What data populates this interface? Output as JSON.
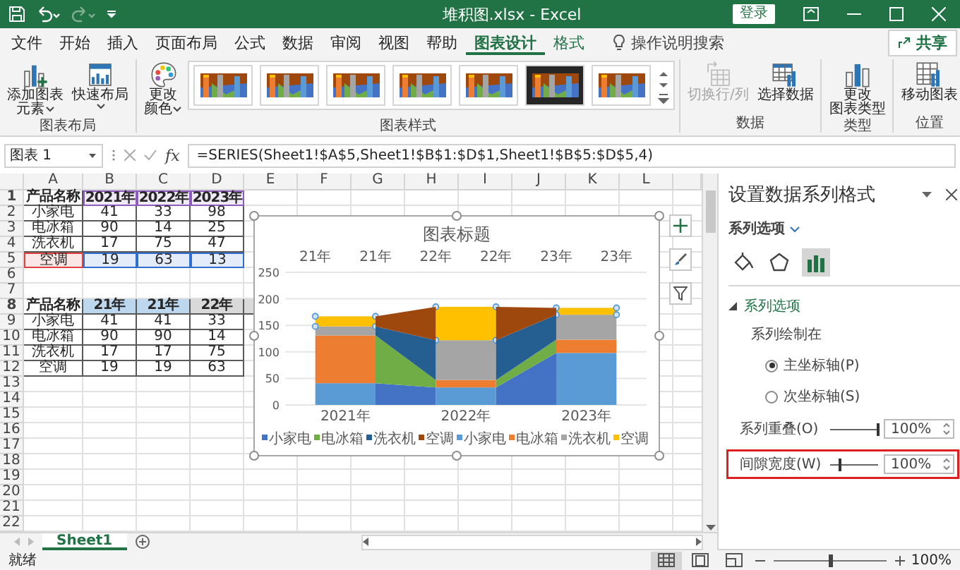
{
  "window": {
    "title": "堆积图.xlsx - Excel",
    "sign_in": "登录"
  },
  "quick_access": [
    {
      "kind": "save",
      "disabled": false
    },
    {
      "kind": "undo",
      "disabled": false
    },
    {
      "kind": "redo",
      "disabled": true
    },
    {
      "kind": "customize",
      "disabled": false
    }
  ],
  "tabs": [
    {
      "label": "文件",
      "selected": false,
      "contextual": false
    },
    {
      "label": "开始",
      "selected": false,
      "contextual": false
    },
    {
      "label": "插入",
      "selected": false,
      "contextual": false
    },
    {
      "label": "页面布局",
      "selected": false,
      "contextual": false
    },
    {
      "label": "公式",
      "selected": false,
      "contextual": false
    },
    {
      "label": "数据",
      "selected": false,
      "contextual": false
    },
    {
      "label": "审阅",
      "selected": false,
      "contextual": false
    },
    {
      "label": "视图",
      "selected": false,
      "contextual": false
    },
    {
      "label": "帮助",
      "selected": false,
      "contextual": false
    },
    {
      "label": "图表设计",
      "selected": true,
      "contextual": true
    },
    {
      "label": "格式",
      "selected": false,
      "contextual": true
    }
  ],
  "tell_me": "操作说明搜索",
  "share": "共享",
  "ribbon_groups": [
    {
      "label": "图表布局",
      "buttons": [
        {
          "kind": "add-element",
          "lines": [
            "添加图表",
            "元素"
          ],
          "dropdown": true,
          "disabled": false
        },
        {
          "kind": "quick-layout",
          "lines": [
            "快速布局"
          ],
          "dropdown": true,
          "disabled": false
        }
      ]
    },
    {
      "label": "图表样式",
      "buttons": [
        {
          "kind": "colors",
          "lines": [
            "更改",
            "颜色"
          ],
          "dropdown": true,
          "disabled": false
        }
      ],
      "styles": [
        {
          "kind": "light"
        },
        {
          "kind": "light"
        },
        {
          "kind": "light"
        },
        {
          "kind": "light"
        },
        {
          "kind": "light"
        },
        {
          "kind": "dark"
        },
        {
          "kind": "light"
        }
      ]
    },
    {
      "label": "数据",
      "buttons": [
        {
          "kind": "switch",
          "lines": [
            "切换行/列"
          ],
          "dropdown": false,
          "disabled": true
        },
        {
          "kind": "select-data",
          "lines": [
            "选择数据"
          ],
          "dropdown": false,
          "disabled": false
        }
      ]
    },
    {
      "label": "类型",
      "buttons": [
        {
          "kind": "change-type",
          "lines": [
            "更改",
            "图表类型"
          ],
          "dropdown": false,
          "disabled": false
        }
      ]
    },
    {
      "label": "位置",
      "buttons": [
        {
          "kind": "move",
          "lines": [
            "移动图表"
          ],
          "dropdown": false,
          "disabled": false
        }
      ]
    }
  ],
  "formula_bar": {
    "name_box": "图表 1",
    "function_label": "fx",
    "formula": "=SERIES(Sheet1!$A$5,Sheet1!$B$1:$D$1,Sheet1!$B$5:$D$5,4)"
  },
  "grid": {
    "columns": [
      "A",
      "B",
      "C",
      "D",
      "E",
      "F",
      "G",
      "H",
      "I",
      "J",
      "K",
      "L"
    ],
    "rows": [
      {
        "number": "1",
        "header": true,
        "cells": [
          {
            "text": "产品名称"
          },
          {
            "text": "2021年",
            "kind": "range",
            "color": "#8e5bbf"
          },
          {
            "text": "2022年",
            "kind": "range",
            "color": "#8e5bbf"
          },
          {
            "text": "2023年",
            "kind": "range",
            "color": "#8e5bbf"
          }
        ]
      },
      {
        "number": "2",
        "header": false,
        "cells": [
          {
            "text": "小家电"
          },
          {
            "text": "41"
          },
          {
            "text": "33"
          },
          {
            "text": "98"
          }
        ]
      },
      {
        "number": "3",
        "header": false,
        "cells": [
          {
            "text": "电冰箱"
          },
          {
            "text": "90"
          },
          {
            "text": "14"
          },
          {
            "text": "25"
          }
        ]
      },
      {
        "number": "4",
        "header": false,
        "cells": [
          {
            "text": "洗衣机"
          },
          {
            "text": "17"
          },
          {
            "text": "75"
          },
          {
            "text": "47"
          }
        ]
      },
      {
        "number": "5",
        "header": false,
        "cells": [
          {
            "text": "空调",
            "kind": "range",
            "color": "#e04040"
          },
          {
            "text": "19",
            "kind": "range",
            "color": "#2f6fd1"
          },
          {
            "text": "63",
            "kind": "range",
            "color": "#2f6fd1"
          },
          {
            "text": "13",
            "kind": "range",
            "color": "#2f6fd1"
          }
        ]
      },
      {
        "number": "6"
      },
      {
        "number": "7"
      },
      {
        "number": "8",
        "header": true,
        "cells": [
          {
            "text": "产品名称"
          },
          {
            "text": "21年",
            "kind": "fill",
            "color": "#bdd7ee"
          },
          {
            "text": "21年",
            "kind": "fill",
            "color": "#bdd7ee"
          },
          {
            "text": "22年",
            "kind": "fill",
            "color": "#d9d9d9"
          },
          {
            "kind": "fill",
            "color": "#d9d9d9"
          }
        ]
      },
      {
        "number": "9",
        "header": false,
        "cells": [
          {
            "text": "小家电"
          },
          {
            "text": "41"
          },
          {
            "text": "41"
          },
          {
            "text": "33"
          }
        ]
      },
      {
        "number": "10",
        "header": false,
        "cells": [
          {
            "text": "电冰箱"
          },
          {
            "text": "90"
          },
          {
            "text": "90"
          },
          {
            "text": "14"
          }
        ]
      },
      {
        "number": "11",
        "header": false,
        "cells": [
          {
            "text": "洗衣机"
          },
          {
            "text": "17"
          },
          {
            "text": "17"
          },
          {
            "text": "75"
          }
        ]
      },
      {
        "number": "12",
        "header": false,
        "cells": [
          {
            "text": "空调"
          },
          {
            "text": "19"
          },
          {
            "text": "19"
          },
          {
            "text": "63"
          }
        ]
      },
      {
        "number": "13"
      },
      {
        "number": "14"
      },
      {
        "number": "15"
      },
      {
        "number": "16"
      },
      {
        "number": "17"
      },
      {
        "number": "18"
      },
      {
        "number": "19"
      },
      {
        "number": "20"
      },
      {
        "number": "21"
      },
      {
        "number": "22"
      }
    ]
  },
  "chart": {
    "selected": true,
    "chart_data": {
      "type": "bar",
      "stacked": true,
      "title": "图表标题",
      "categories": [
        "2021年",
        "2022年",
        "2023年"
      ],
      "ylim": [
        0,
        250
      ],
      "yticks": [
        0,
        50,
        100,
        150,
        200,
        250
      ],
      "grid": true,
      "legend": "bottom",
      "series": [
        {
          "name": "小家电",
          "color": "#5b9bd5",
          "values": [
            41,
            33,
            98
          ]
        },
        {
          "name": "电冰箱",
          "color": "#ed7d31",
          "values": [
            90,
            14,
            25
          ]
        },
        {
          "name": "洗衣机",
          "color": "#a5a5a5",
          "values": [
            17,
            75,
            47
          ]
        },
        {
          "name": "空调",
          "color": "#ffc000",
          "values": [
            19,
            63,
            13
          ]
        }
      ]
    },
    "column_selection": [
      {
        "selected": false
      },
      {
        "selected": false
      },
      {
        "selected": false
      },
      {
        "selected": true
      }
    ],
    "overlay": {
      "chart_data": {
        "type": "area",
        "stacked": true,
        "x": [
          "21年",
          "21年",
          "22年",
          "22年",
          "23年",
          "23年"
        ],
        "ylim": [
          0,
          250
        ],
        "legend": "bottom",
        "series": [
          {
            "name": "小家电",
            "color": "#4472c4",
            "values": [
              null,
              41,
              33,
              33,
              98,
              null
            ]
          },
          {
            "name": "电冰箱",
            "color": "#70ad47",
            "values": [
              null,
              90,
              14,
              14,
              25,
              null
            ]
          },
          {
            "name": "洗衣机",
            "color": "#255e91",
            "values": [
              null,
              17,
              75,
              75,
              47,
              null
            ]
          },
          {
            "name": "空调",
            "color": "#9e480e",
            "values": [
              null,
              19,
              63,
              63,
              13,
              null
            ]
          }
        ]
      }
    }
  },
  "sheet_tabs": [
    {
      "label": "Sheet1",
      "selected": true
    }
  ],
  "format_pane": {
    "title": "设置数据系列格式",
    "options_menu": "系列选项",
    "icons": [
      {
        "kind": "fill",
        "selected": false
      },
      {
        "kind": "effects",
        "selected": false
      },
      {
        "kind": "series",
        "selected": true
      }
    ],
    "section": {
      "title": "系列选项",
      "expanded": true
    },
    "plot_on_label": "系列绘制在",
    "axes": [
      {
        "label": "主坐标轴(P)",
        "selected": true
      },
      {
        "label": "次坐标轴(S)",
        "selected": false
      }
    ],
    "settings": [
      {
        "label": "系列重叠(O)",
        "value": "100%",
        "level": 1,
        "highlighted": false
      },
      {
        "label": "间隙宽度(W)",
        "value": "100%",
        "level": 0.2,
        "highlighted": true
      }
    ]
  },
  "status_bar": {
    "text": "就绪",
    "views": [
      {
        "kind": "normal",
        "selected": true
      },
      {
        "kind": "page-layout",
        "selected": false
      },
      {
        "kind": "page-break",
        "selected": false
      }
    ],
    "zoom": {
      "level": 0.5,
      "value": "100%"
    }
  }
}
